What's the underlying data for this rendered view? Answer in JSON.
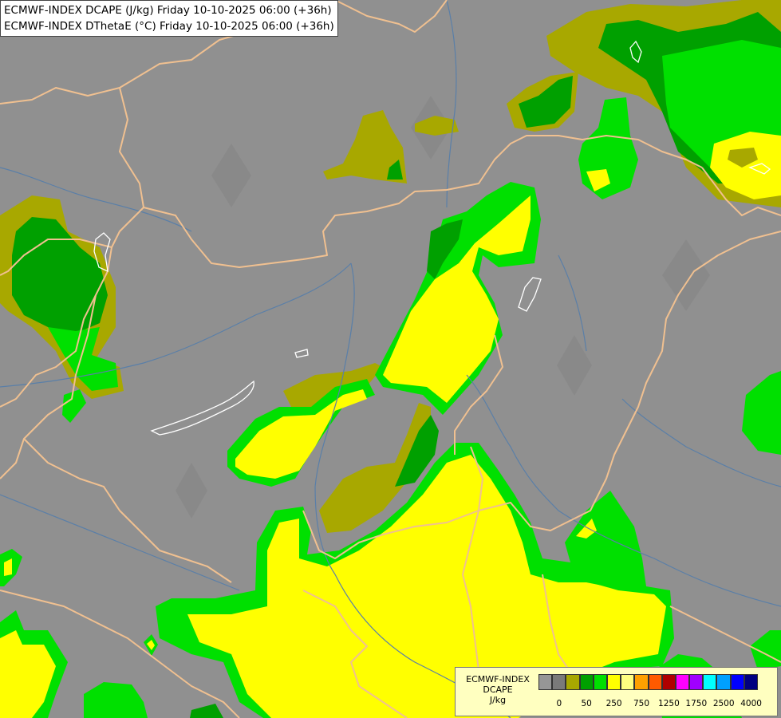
{
  "header": {
    "line1": "ECMWF-INDEX DCAPE (J/kg) Friday 10-10-2025 06:00 (+36h)",
    "line2": "ECMWF-INDEX DThetaE (°C) Friday 10-10-2025 06:00 (+36h)"
  },
  "legend": {
    "model": "ECMWF-INDEX",
    "variable": "DCAPE",
    "unit": "J/kg",
    "colors": [
      "#969696",
      "#7a7a7a",
      "#a8a800",
      "#00a000",
      "#00e000",
      "#ffff00",
      "#ffff80",
      "#ffa000",
      "#ff5a00",
      "#b00000",
      "#ff00ff",
      "#a000ff",
      "#00ffff",
      "#00a0ff",
      "#0000ff",
      "#000080"
    ],
    "tick_labels": [
      "0",
      "50",
      "250",
      "750",
      "1250",
      "1750",
      "2500",
      "4000"
    ]
  },
  "map_colors": {
    "background": "#909090",
    "border": "#f0c090",
    "river": "#5a7fa8",
    "lake": "#ffffff",
    "olive": "#a8a800",
    "dark_green": "#00a000",
    "green": "#00e000",
    "yellow": "#ffff00"
  }
}
